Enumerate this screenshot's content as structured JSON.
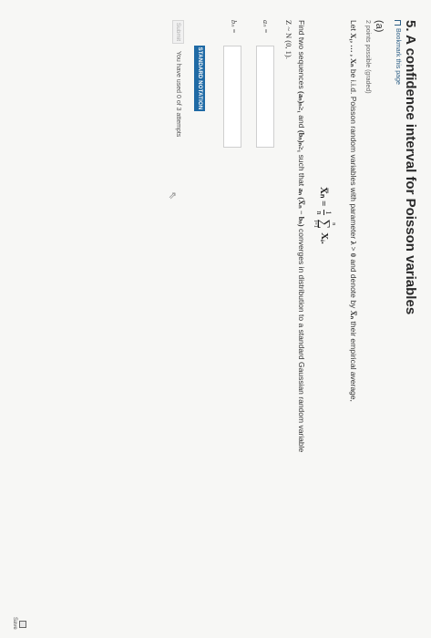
{
  "problem": {
    "title": "5. A confidence interval for Poisson variables",
    "bookmark_label": "Bookmark this page",
    "part": "(a)",
    "points": "2 points possible (graded)"
  },
  "statement": {
    "line1_a": "Let",
    "line1_vars": "X₁, … , Xₙ",
    "line1_b": "be i.i.d. Poisson random variables with parameter",
    "line1_param": "λ > 0",
    "line1_c": "and denote by",
    "line1_mean": "X̅ₙ",
    "line1_d": "their empirical average,",
    "formula_lhs": "X̅ₙ =",
    "formula_num": "1",
    "formula_den": "n",
    "formula_sum_top": "n",
    "formula_sum_bottom": "i=1",
    "formula_term": "Xᵢ.",
    "line2_a": "Find two sequences",
    "line2_seq_a": "(aₙ)ₙ≥₁",
    "line2_and": "and",
    "line2_seq_b": "(bₙ)ₙ≥₁",
    "line2_b": "such that",
    "line2_expr": "aₙ (X̅ₙ − bₙ)",
    "line2_c": "converges in distribution to a standard Gaussian random variable",
    "line3": "Z ~ N (0, 1)."
  },
  "answers": {
    "an_label": "aₙ =",
    "bn_label": "bₙ =",
    "an_value": "",
    "bn_value": ""
  },
  "buttons": {
    "notation": "STANDARD NOTATION",
    "submit": "Submit",
    "attempts": "You have used 0 of 3 attempts",
    "save": "Save"
  }
}
